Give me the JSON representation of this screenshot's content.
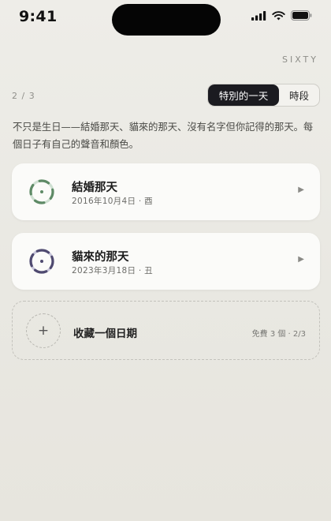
{
  "status_bar": {
    "time": "9:41"
  },
  "brand": "SIXTY",
  "page_indicator": "2 / 3",
  "segmented": {
    "active": "特別的一天",
    "inactive": "時段"
  },
  "description": "不只是生日——結婚那天、貓來的那天、沒有名字但你記得的那天。每個日子有自己的聲音和顏色。",
  "cards": [
    {
      "title": "結婚那天",
      "subtitle": "2016年10月4日 · 酉",
      "color": "#5e8a66",
      "ring_light": "#cfe0d2"
    },
    {
      "title": "貓來的那天",
      "subtitle": "2023年3月18日 · 丑",
      "color": "#4f4a70",
      "ring_light": "#c8c6da"
    }
  ],
  "add": {
    "icon": "+",
    "label": "收藏一個日期",
    "quota": "免費 3 個 · 2/3"
  },
  "icons": [
    "signal-icon",
    "wifi-icon",
    "battery-icon",
    "chevron-right-icon",
    "plus-icon"
  ]
}
